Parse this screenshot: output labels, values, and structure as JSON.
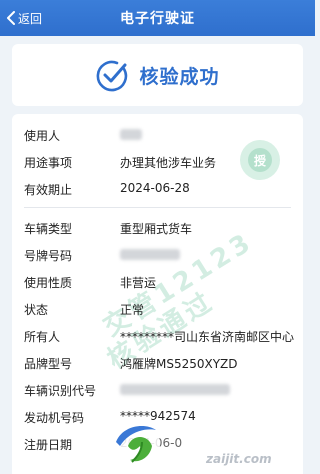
{
  "header": {
    "back_label": "返回",
    "title": "电子行驶证"
  },
  "status": {
    "text": "核验成功"
  },
  "badge": {
    "text": "授"
  },
  "watermark": {
    "line1": "交管12123",
    "line2": "核验通过"
  },
  "site_text": "zaijit.com",
  "rows": [
    {
      "label": "使用人",
      "value": ""
    },
    {
      "label": "用途事项",
      "value": "办理其他涉车业务"
    },
    {
      "label": "有效期止",
      "value": "2024-06-28"
    },
    {
      "label": "车辆类型",
      "value": "重型厢式货车"
    },
    {
      "label": "号牌号码",
      "value": ""
    },
    {
      "label": "使用性质",
      "value": "非营运"
    },
    {
      "label": "状态",
      "value": "正常"
    },
    {
      "label": "所有人",
      "value": "*********司山东省济南邮区中心"
    },
    {
      "label": "品牌型号",
      "value": "鸿雁牌MS5250XYZD"
    },
    {
      "label": "车辆识别代号",
      "value": ""
    },
    {
      "label": "发动机号码",
      "value": "*****942574"
    },
    {
      "label": "注册日期",
      "value": "2014-06-0"
    }
  ],
  "colors": {
    "header": "#2f6fcd",
    "accent": "#2f6fcd",
    "watermark": "#9fd9c0"
  },
  "icons": {
    "back": "chevron-left-icon",
    "status": "check-circle-icon",
    "logo": "leaf-logo-icon"
  }
}
